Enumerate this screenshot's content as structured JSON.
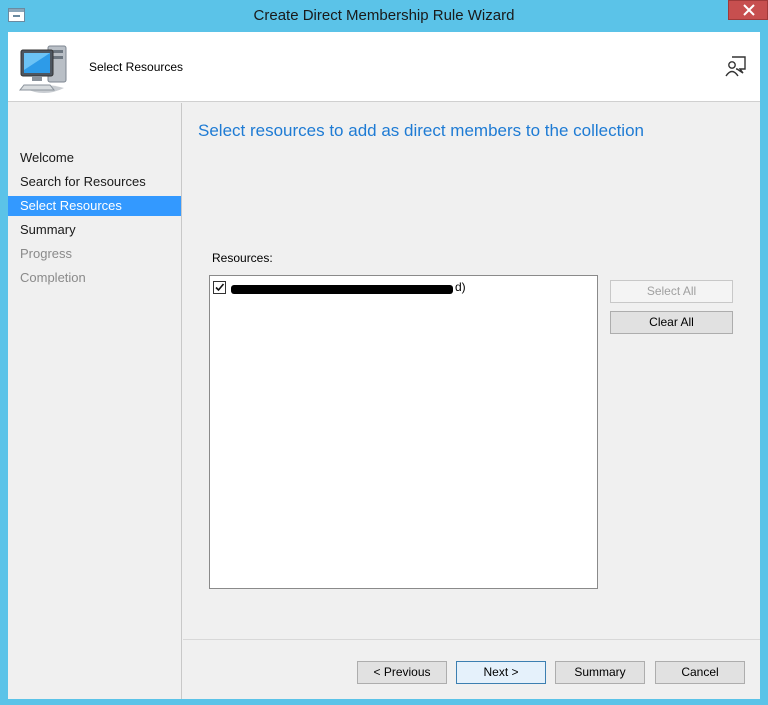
{
  "window": {
    "title": "Create Direct Membership Rule Wizard"
  },
  "header": {
    "title": "Select Resources",
    "icon": "computer-icon",
    "help_icon": "help-person-icon"
  },
  "sidebar": {
    "items": [
      {
        "label": "Welcome",
        "state": "normal"
      },
      {
        "label": "Search for Resources",
        "state": "normal"
      },
      {
        "label": "Select Resources",
        "state": "active"
      },
      {
        "label": "Summary",
        "state": "normal"
      },
      {
        "label": "Progress",
        "state": "disabled"
      },
      {
        "label": "Completion",
        "state": "disabled"
      }
    ]
  },
  "main": {
    "heading": "Select resources to add as direct members to the collection",
    "resources_label": "Resources:",
    "resources": [
      {
        "checked": true,
        "text_suffix": "d)"
      }
    ],
    "select_all_label": "Select All",
    "clear_all_label": "Clear All"
  },
  "footer": {
    "previous_label": "< Previous",
    "next_label": "Next >",
    "summary_label": "Summary",
    "cancel_label": "Cancel"
  },
  "colors": {
    "accent": "#3399ff",
    "heading": "#1e7bd4",
    "window_frame": "#5bc3e8",
    "close": "#c74f4f"
  }
}
